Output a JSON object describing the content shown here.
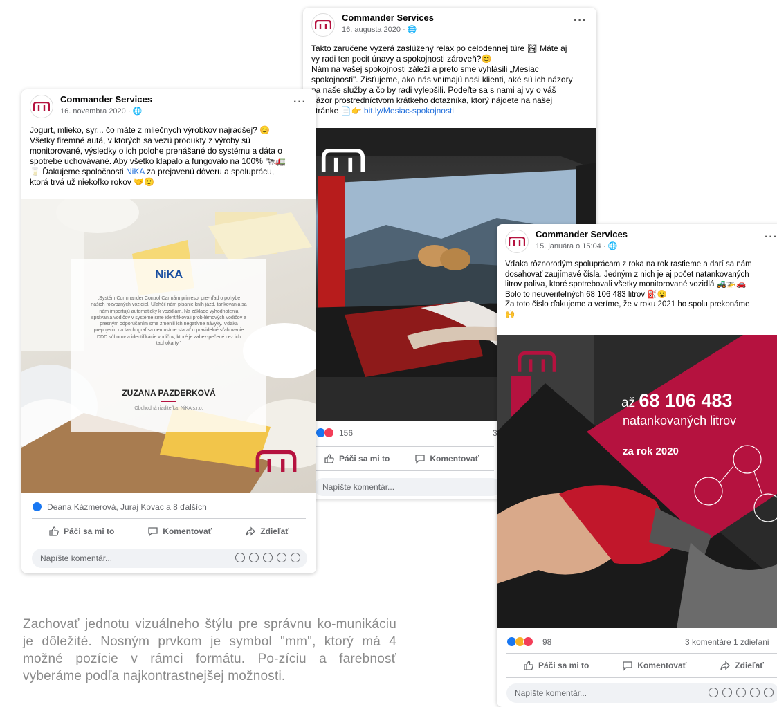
{
  "colors": {
    "brand_red": "#b5123f",
    "fb_blue": "#1877f2",
    "love": "#f33e58",
    "muted": "#65676b"
  },
  "post_center": {
    "author": "Commander Services",
    "meta": "16. augusta 2020 · ",
    "text_lines": [
      "Takto zaručene vyzerá zaslúžený relax po celodennej túre 🏞 Máte aj",
      "vy radi ten pocit únavy a spokojnosti zároveň?😊",
      "Nám na vašej spokojnosti záleží a preto sme vyhlásili „Mesiac",
      "spokojnosti\". Zisťujeme, ako nás vnímajú naši klienti, aké sú ich názory",
      "na naše služby a čo by radi vylepšili. Podeľte sa s nami aj vy o váš",
      "názor prostredníctvom krátkeho dotazníka, ktorý nájdete na našej",
      "stránke 📄👉 "
    ],
    "link": "bit.ly/Mesiac-spokojnosti",
    "reactions_count": "156",
    "reactions_tail": "3",
    "like_label": "Páči sa mi to",
    "comment_label": "Komentovať",
    "comment_placeholder": "Napíšte komentár..."
  },
  "post_left": {
    "author": "Commander Services",
    "meta": "16. novembra 2020 · ",
    "text_lines": [
      "Jogurt, mlieko, syr... čo máte z mliečnych výrobkov najradšej? 😊",
      "Všetky firemné autá, v ktorých sa vezú produkty z výroby sú",
      "monitorované, výsledky o ich polohe prenášané do systému a dáta o",
      "spotrebe uchovávané. Aby všetko klapalo a fungovalo na 100% 🐄🚛"
    ],
    "thanks_before": "🥛 Ďakujeme spoločnosti ",
    "thanks_link": "NiKA",
    "thanks_after": " za prejavenú dôveru a spoluprácu,",
    "last_line": "ktorá trvá už niekoľko rokov 🤝🙂",
    "overlay": {
      "logo": "NiKA",
      "quote": "„Systém Commander Control Car nám priniesol pre-hľad o pohybe našich rozvozných vozidiel. Uľahčil nám písanie kníh jázd, tankovania sa nám importujú automaticky k vozidlám. Na základe vyhodnotenia správania vodičov v systéme sme identifikovali prob-lémových vodičov a presným odporúčaním sme zmenili ich negatívne návyky. Vďaka prepojeniu na ta-chograf sa nemusíme starať o pravidelné sťahovanie DDD súborov a identifikácie vodičov, ktoré je zabez-pečené cez ich tachokarty.\"",
      "name": "ZUZANA PAZDERKOVÁ",
      "role": "Obchodná riaditeľka, NiKA s.r.o."
    },
    "reactors": "Deana Kázmerová, Juraj Kovac a 8 ďalších",
    "like_label": "Páči sa mi to",
    "comment_label": "Komentovať",
    "share_label": "Zdieľať",
    "comment_placeholder": "Napíšte komentár..."
  },
  "post_right": {
    "author": "Commander Services",
    "meta": "15. januára o 15:04 · ",
    "text_lines": [
      "Vďaka rôznorodým spoluprácam z roka na rok rastieme a darí sa nám",
      "dosahovať zaujímavé čísla. Jedným z nich je aj počet natankovaných",
      "litrov paliva, ktoré spotrebovali všetky monitorované vozidlá 🚜🚁🚗",
      "Bolo to neuveriteľných 68 106 483 litrov ⛽😮",
      "Za toto číslo ďakujeme a veríme, že v roku 2021 ho spolu prekonáme",
      "🙌"
    ],
    "banner_prefix": "až ",
    "banner_number": "68 106 483",
    "banner_line2": "natankovaných litrov",
    "banner_year": "za rok 2020",
    "reactions_count": "98",
    "stats_right": "3 komentáre  1 zdieľani",
    "like_label": "Páči sa mi to",
    "comment_label": "Komentovať",
    "share_label": "Zdieľať",
    "comment_placeholder": "Napíšte komentár..."
  },
  "footer_text": "Zachovať jednotu vizuálneho štýlu pre správnu ko-munikáciu je dôležité. Nosným prvkom je symbol \"mm\", ktorý má 4 možné pozície v rámci formátu. Po-zíciu a farebnosť vyberáme podľa najkontrastnejšej možnosti."
}
